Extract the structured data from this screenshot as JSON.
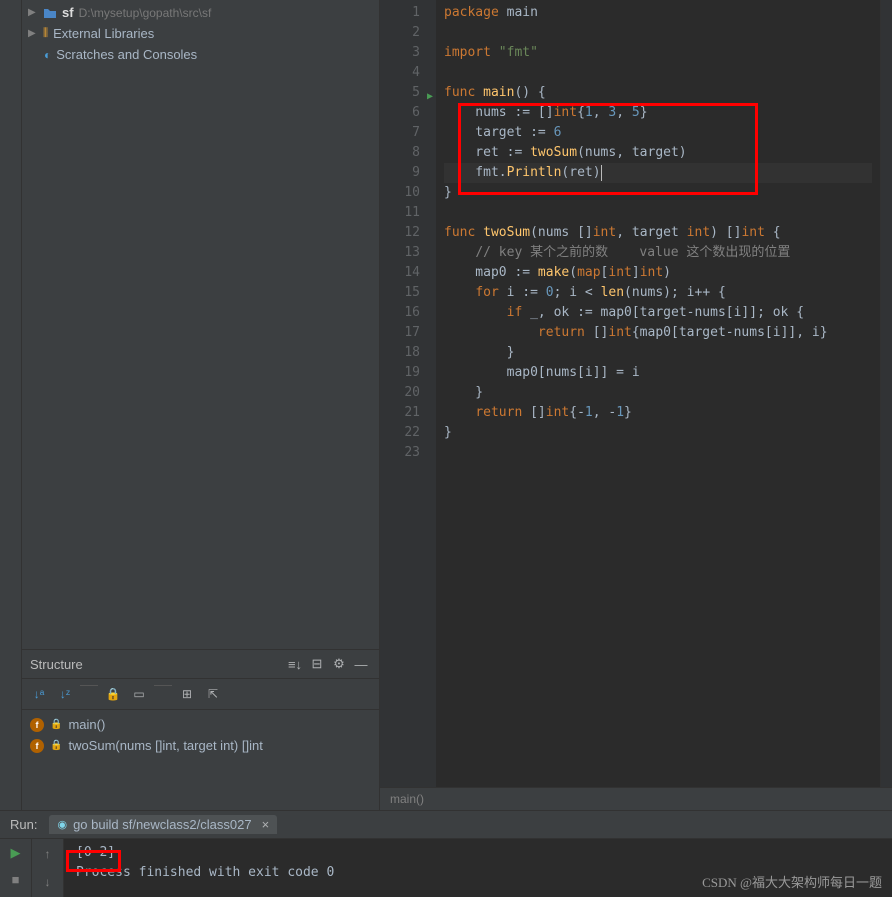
{
  "project": {
    "root_name": "sf",
    "root_path": "D:\\mysetup\\gopath\\src\\sf",
    "external_libs": "External Libraries",
    "scratches": "Scratches and Consoles"
  },
  "structure": {
    "title": "Structure",
    "items": [
      {
        "name": "main()"
      },
      {
        "name": "twoSum(nums []int, target int) []int"
      }
    ]
  },
  "code": {
    "lines": [
      [
        {
          "t": "kw",
          "v": "package"
        },
        {
          "t": "ident",
          "v": " main"
        }
      ],
      [],
      [
        {
          "t": "kw",
          "v": "import"
        },
        {
          "t": "ident",
          "v": " "
        },
        {
          "t": "str",
          "v": "\"fmt\""
        }
      ],
      [],
      [
        {
          "t": "kw",
          "v": "func"
        },
        {
          "t": "ident",
          "v": " "
        },
        {
          "t": "fn",
          "v": "main"
        },
        {
          "t": "ident",
          "v": "() {"
        }
      ],
      [
        {
          "t": "ident",
          "v": "    nums := []"
        },
        {
          "t": "typ",
          "v": "int"
        },
        {
          "t": "ident",
          "v": "{"
        },
        {
          "t": "num",
          "v": "1"
        },
        {
          "t": "ident",
          "v": ", "
        },
        {
          "t": "num",
          "v": "3"
        },
        {
          "t": "ident",
          "v": ", "
        },
        {
          "t": "num",
          "v": "5"
        },
        {
          "t": "ident",
          "v": "}"
        }
      ],
      [
        {
          "t": "ident",
          "v": "    target := "
        },
        {
          "t": "num",
          "v": "6"
        }
      ],
      [
        {
          "t": "ident",
          "v": "    ret := "
        },
        {
          "t": "fn",
          "v": "twoSum"
        },
        {
          "t": "ident",
          "v": "(nums, target)"
        }
      ],
      [
        {
          "t": "ident",
          "v": "    fmt."
        },
        {
          "t": "fn",
          "v": "Println"
        },
        {
          "t": "ident",
          "v": "(ret)"
        }
      ],
      [
        {
          "t": "ident",
          "v": "}"
        }
      ],
      [],
      [
        {
          "t": "kw",
          "v": "func"
        },
        {
          "t": "ident",
          "v": " "
        },
        {
          "t": "fn",
          "v": "twoSum"
        },
        {
          "t": "ident",
          "v": "(nums []"
        },
        {
          "t": "typ",
          "v": "int"
        },
        {
          "t": "ident",
          "v": ", target "
        },
        {
          "t": "typ",
          "v": "int"
        },
        {
          "t": "ident",
          "v": ") []"
        },
        {
          "t": "typ",
          "v": "int"
        },
        {
          "t": "ident",
          "v": " {"
        }
      ],
      [
        {
          "t": "ident",
          "v": "    "
        },
        {
          "t": "com",
          "v": "// key 某个之前的数    value 这个数出现的位置"
        }
      ],
      [
        {
          "t": "ident",
          "v": "    map0 := "
        },
        {
          "t": "fn",
          "v": "make"
        },
        {
          "t": "ident",
          "v": "("
        },
        {
          "t": "typ",
          "v": "map"
        },
        {
          "t": "ident",
          "v": "["
        },
        {
          "t": "typ",
          "v": "int"
        },
        {
          "t": "ident",
          "v": "]"
        },
        {
          "t": "typ",
          "v": "int"
        },
        {
          "t": "ident",
          "v": ")"
        }
      ],
      [
        {
          "t": "ident",
          "v": "    "
        },
        {
          "t": "kw",
          "v": "for"
        },
        {
          "t": "ident",
          "v": " i := "
        },
        {
          "t": "num",
          "v": "0"
        },
        {
          "t": "ident",
          "v": "; i < "
        },
        {
          "t": "fn",
          "v": "len"
        },
        {
          "t": "ident",
          "v": "(nums); i++ {"
        }
      ],
      [
        {
          "t": "ident",
          "v": "        "
        },
        {
          "t": "kw",
          "v": "if"
        },
        {
          "t": "ident",
          "v": " _, ok := map0[target-nums[i]]; ok {"
        }
      ],
      [
        {
          "t": "ident",
          "v": "            "
        },
        {
          "t": "kw",
          "v": "return"
        },
        {
          "t": "ident",
          "v": " []"
        },
        {
          "t": "typ",
          "v": "int"
        },
        {
          "t": "ident",
          "v": "{map0[target-nums[i]], i}"
        }
      ],
      [
        {
          "t": "ident",
          "v": "        }"
        }
      ],
      [
        {
          "t": "ident",
          "v": "        map0[nums[i]] = i"
        }
      ],
      [
        {
          "t": "ident",
          "v": "    }"
        }
      ],
      [
        {
          "t": "ident",
          "v": "    "
        },
        {
          "t": "kw",
          "v": "return"
        },
        {
          "t": "ident",
          "v": " []"
        },
        {
          "t": "typ",
          "v": "int"
        },
        {
          "t": "ident",
          "v": "{-"
        },
        {
          "t": "num",
          "v": "1"
        },
        {
          "t": "ident",
          "v": ", -"
        },
        {
          "t": "num",
          "v": "1"
        },
        {
          "t": "ident",
          "v": "}"
        }
      ],
      [
        {
          "t": "ident",
          "v": "}"
        }
      ],
      []
    ],
    "gutter_run_lines": [
      5
    ],
    "fold_lines": [
      5,
      10,
      12,
      15,
      16,
      18,
      20,
      22
    ],
    "current_line": 9
  },
  "breadcrumb": "main()",
  "run": {
    "label": "Run:",
    "config_name": "go build sf/newclass2/class027",
    "output": [
      "",
      "[0 2]",
      "",
      "Process finished with exit code 0"
    ]
  },
  "watermark": "CSDN @福大大架构师每日一题"
}
